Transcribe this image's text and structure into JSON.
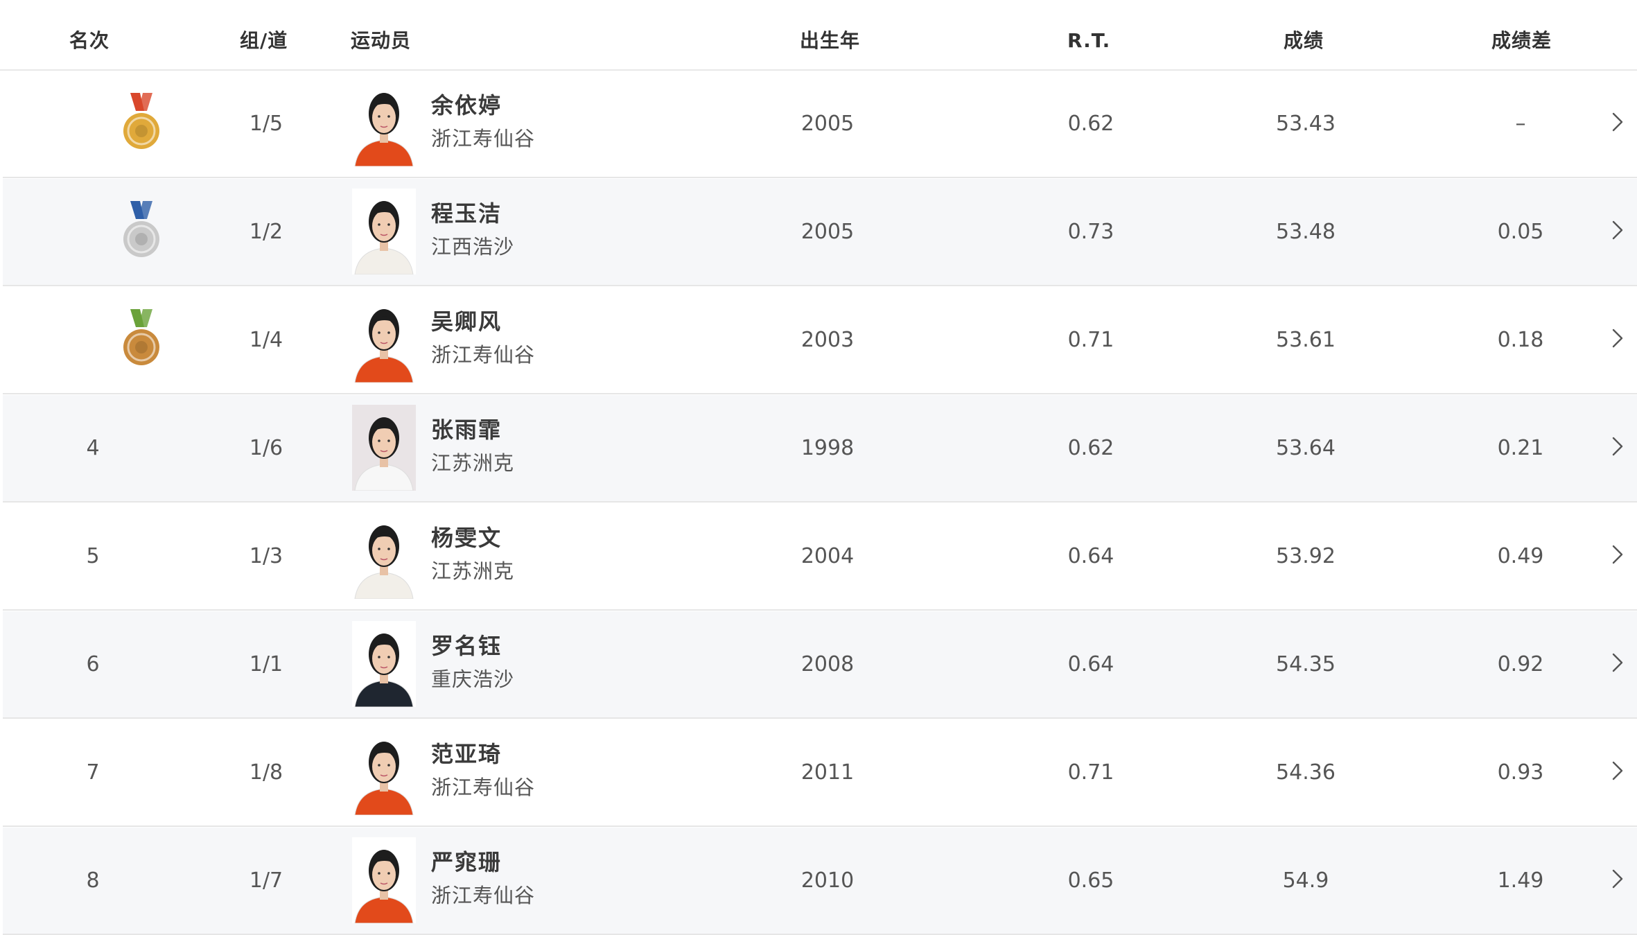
{
  "header": {
    "rank": "名次",
    "lane": "组/道",
    "athlete": "运动员",
    "birth_year": "出生年",
    "reaction_time": "R.T.",
    "result": "成绩",
    "gap": "成绩差"
  },
  "rows": [
    {
      "rank": "1",
      "medal": "gold",
      "lane": "1/5",
      "name": "余依婷",
      "team": "浙江寿仙谷",
      "year": "2005",
      "rt": "0.62",
      "result": "53.43",
      "gap": "–",
      "kit": "red"
    },
    {
      "rank": "2",
      "medal": "silver",
      "lane": "1/2",
      "name": "程玉洁",
      "team": "江西浩沙",
      "year": "2005",
      "rt": "0.73",
      "result": "53.48",
      "gap": "0.05",
      "kit": "white"
    },
    {
      "rank": "3",
      "medal": "bronze",
      "lane": "1/4",
      "name": "吴卿风",
      "team": "浙江寿仙谷",
      "year": "2003",
      "rt": "0.71",
      "result": "53.61",
      "gap": "0.18",
      "kit": "red"
    },
    {
      "rank": "4",
      "medal": "",
      "lane": "1/6",
      "name": "张雨霏",
      "team": "江苏洲克",
      "year": "1998",
      "rt": "0.62",
      "result": "53.64",
      "gap": "0.21",
      "kit": "light"
    },
    {
      "rank": "5",
      "medal": "",
      "lane": "1/3",
      "name": "杨雯文",
      "team": "江苏洲克",
      "year": "2004",
      "rt": "0.64",
      "result": "53.92",
      "gap": "0.49",
      "kit": "white"
    },
    {
      "rank": "6",
      "medal": "",
      "lane": "1/1",
      "name": "罗名钰",
      "team": "重庆浩沙",
      "year": "2008",
      "rt": "0.64",
      "result": "54.35",
      "gap": "0.92",
      "kit": "dark"
    },
    {
      "rank": "7",
      "medal": "",
      "lane": "1/8",
      "name": "范亚琦",
      "team": "浙江寿仙谷",
      "year": "2011",
      "rt": "0.71",
      "result": "54.36",
      "gap": "0.93",
      "kit": "red"
    },
    {
      "rank": "8",
      "medal": "",
      "lane": "1/7",
      "name": "严窕珊",
      "team": "浙江寿仙谷",
      "year": "2010",
      "rt": "0.65",
      "result": "54.9",
      "gap": "1.49",
      "kit": "red"
    }
  ],
  "colors": {
    "gold": "#e0a93a",
    "silver": "#c9c9c9",
    "bronze": "#c98a3c",
    "kit_red": "#e24a1b",
    "kit_dark": "#1f2630",
    "kit_white": "#f2efe9"
  },
  "icons": {
    "row_action": "chevron-right-icon",
    "medal": "medal-icon"
  }
}
